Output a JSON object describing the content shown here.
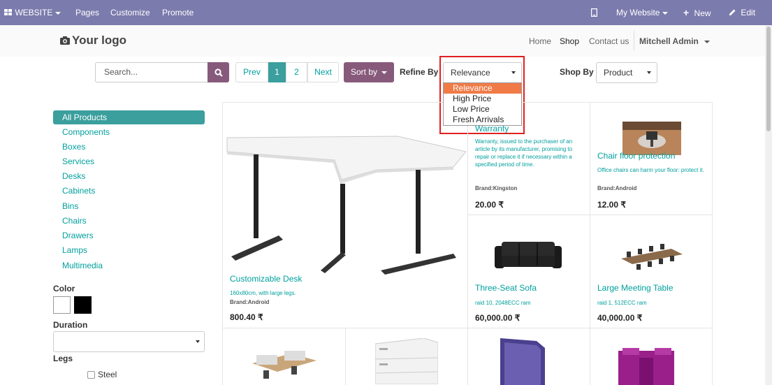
{
  "topbar": {
    "website_label": "WEBSITE",
    "pages": "Pages",
    "customize": "Customize",
    "promote": "Promote",
    "my_website": "My Website",
    "new": "New",
    "edit": "Edit"
  },
  "header": {
    "logo": "Your logo",
    "nav": {
      "home": "Home",
      "shop": "Shop",
      "contact": "Contact us",
      "user": "Mitchell Admin"
    }
  },
  "toolbar": {
    "search_placeholder": "Search...",
    "prev": "Prev",
    "page1": "1",
    "page2": "2",
    "next": "Next",
    "sort_by": "Sort by",
    "refine_by_label": "Refine By",
    "refine_value": "Relevance",
    "shop_by_label": "Shop By",
    "shop_by_value": "Product"
  },
  "refine_options": [
    "Relevance",
    "High Price",
    "Low Price",
    "Fresh Arrivals"
  ],
  "categories": [
    "All Products",
    "Components",
    "Boxes",
    "Services",
    "Desks",
    "Cabinets",
    "Bins",
    "Chairs",
    "Drawers",
    "Lamps",
    "Multimedia"
  ],
  "filters": {
    "color_label": "Color",
    "colors": [
      "#ffffff",
      "#000000"
    ],
    "duration_label": "Duration",
    "legs_label": "Legs",
    "legs_option": "Steel"
  },
  "products": {
    "desk": {
      "name": "Customizable Desk",
      "desc": "160x80cm, with large legs.",
      "brand_label": "Brand:",
      "brand": "Android",
      "price": "800.40 ₹"
    },
    "warranty": {
      "name": "Warranty",
      "desc": "Warranty, issued to the purchaser of an article by its manufacturer, promising to repair or replace it if necessary within a specified period of time.",
      "brand_label": "Brand:",
      "brand": "Kingston",
      "price": "20.00 ₹"
    },
    "chairfloor": {
      "name": "Chair floor protection",
      "desc": "Office chairs can harm your floor: protect it.",
      "brand_label": "Brand:",
      "brand": "Android",
      "price": "12.00 ₹"
    },
    "sofa": {
      "name": "Three-Seat Sofa",
      "desc": "raid 10, 2048ECC ram",
      "price": "60,000.00 ₹"
    },
    "table": {
      "name": "Large Meeting Table",
      "desc": "raid 1, 512ECC ram",
      "price": "40,000.00 ₹"
    }
  }
}
